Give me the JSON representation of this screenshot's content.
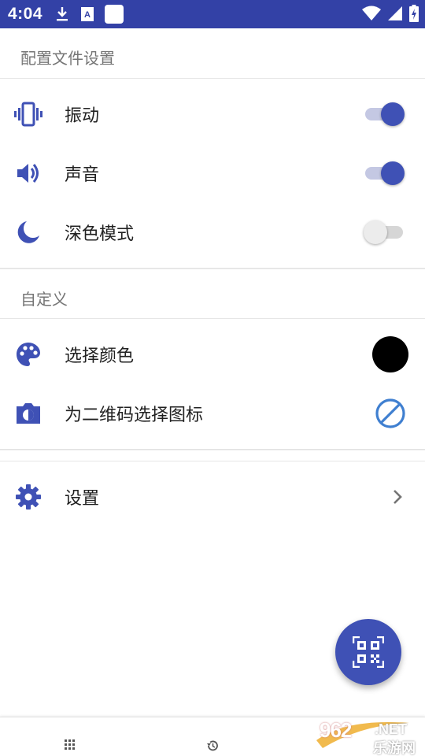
{
  "status_bar": {
    "time": "4:04",
    "icons": [
      "download-icon",
      "a-notification-icon",
      "blank-notification-icon",
      "wifi-icon",
      "signal-icon",
      "battery-charging-icon"
    ]
  },
  "sections": [
    {
      "header": "配置文件设置",
      "items": [
        {
          "label": "振动",
          "icon": "vibration-icon",
          "control": "switch",
          "checked": true
        },
        {
          "label": "声音",
          "icon": "volume-icon",
          "control": "switch",
          "checked": true
        },
        {
          "label": "深色模式",
          "icon": "moon-icon",
          "control": "switch",
          "checked": false
        }
      ]
    },
    {
      "header": "自定义",
      "items": [
        {
          "label": "选择颜色",
          "icon": "palette-icon",
          "control": "color-swatch",
          "color": "#000000"
        },
        {
          "label": "为二维码选择图标",
          "icon": "camera-switch-icon",
          "control": "block-icon"
        }
      ]
    },
    {
      "header": "",
      "items": [
        {
          "label": "设置",
          "icon": "gear-icon",
          "control": "chevron"
        }
      ]
    }
  ],
  "fab": {
    "icon": "qr-code-icon"
  },
  "bottom_nav": {
    "icons": [
      "grid-icon",
      "history-icon"
    ]
  },
  "watermark": {
    "number": "962",
    "suffix": ".NET",
    "name": "乐游网"
  },
  "colors": {
    "status_bar": "#3341a6",
    "accent": "#3f51b5",
    "icon": "#3f51b5"
  }
}
